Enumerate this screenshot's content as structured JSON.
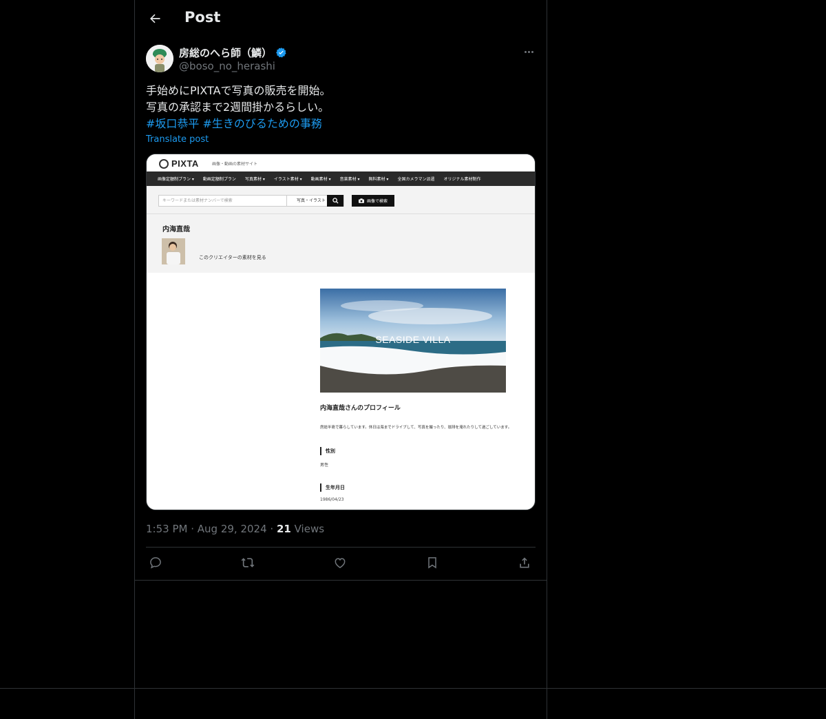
{
  "header": {
    "title": "Post"
  },
  "author": {
    "name": "房総のへら師（鱗）",
    "handle": "@boso_no_herashi"
  },
  "post": {
    "line1": "手始めにPIXTAで写真の販売を開始。",
    "line2": "写真の承認まで2週間掛かるらしい。",
    "hashtag1": "#坂口恭平",
    "hashtag2": "#生きのびるための事務",
    "translate": "Translate post"
  },
  "media": {
    "logo": "PIXTA",
    "tagline": "画像・動画の素材サイト",
    "nav": [
      "画像定額制プラン ▾",
      "動画定額制プラン",
      "写真素材 ▾",
      "イラスト素材 ▾",
      "動画素材 ▾",
      "音楽素材 ▾",
      "無料素材 ▾",
      "全国カメラマン派遣",
      "オリジナル素材制作"
    ],
    "search_placeholder": "キーワードまたは素材ナンバーで検索",
    "search_category": "写真・イラスト ▾",
    "image_search": "画像で検索",
    "creator_name": "内海直哉",
    "creator_link": "このクリエイターの素材を見る",
    "hero_title": "SEASIDE VILLA",
    "profile_heading": "内海直哉さんのプロフィール",
    "profile_text": "房総半島で暮らしています。休日は海までドライブして、写真を撮ったり、珈琲を淹れたりして過ごしています。",
    "gender_label": "性別",
    "gender_value": "男性",
    "birth_label": "生年月日",
    "birth_value": "1986/04/23"
  },
  "meta": {
    "time": "1:53 PM",
    "date": "Aug 29, 2024",
    "views_count": "21",
    "views_label": "Views"
  },
  "icons": [
    "back-arrow-icon",
    "verified-badge-icon",
    "more-icon",
    "reply-icon",
    "retweet-icon",
    "like-icon",
    "bookmark-icon",
    "share-icon"
  ],
  "colors": {
    "accent": "#1d9bf0",
    "border": "#2f3336",
    "muted": "#71767b",
    "text": "#e7e9ea"
  }
}
